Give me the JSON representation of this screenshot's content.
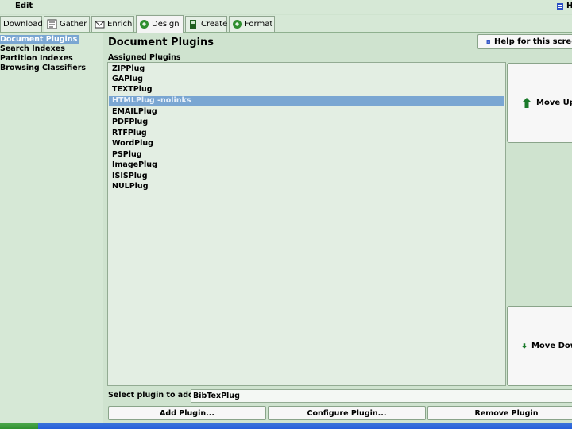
{
  "menu": {
    "edit_label": "Edit",
    "extra_label": "H"
  },
  "tabs": [
    {
      "label": "Download",
      "icon": "none"
    },
    {
      "label": "Gather",
      "icon": "notebook-icon"
    },
    {
      "label": "Enrich",
      "icon": "envelope-icon"
    },
    {
      "label": "Design",
      "icon": "gear-icon"
    },
    {
      "label": "Create",
      "icon": "phone-icon"
    },
    {
      "label": "Format",
      "icon": "gear-icon"
    }
  ],
  "active_tab": "Design",
  "sidebar": {
    "items": [
      {
        "label": "Document Plugins",
        "selected": true
      },
      {
        "label": "Search Indexes",
        "selected": false
      },
      {
        "label": "Partition Indexes",
        "selected": false
      },
      {
        "label": "Browsing Classifiers",
        "selected": false
      }
    ]
  },
  "panel": {
    "title": "Document Plugins",
    "help_label": "Help for this scree",
    "assigned_label": "Assigned Plugins",
    "plugins": [
      {
        "label": "ZIPPlug",
        "selected": false
      },
      {
        "label": "GAPlug",
        "selected": false
      },
      {
        "label": "TEXTPlug",
        "selected": false
      },
      {
        "label": "HTMLPlug -nolinks",
        "selected": true
      },
      {
        "label": "EMAILPlug",
        "selected": false
      },
      {
        "label": "PDFPlug",
        "selected": false
      },
      {
        "label": "RTFPlug",
        "selected": false
      },
      {
        "label": "WordPlug",
        "selected": false
      },
      {
        "label": "PSPlug",
        "selected": false
      },
      {
        "label": "ImagePlug",
        "selected": false
      },
      {
        "label": "ISISPlug",
        "selected": false
      },
      {
        "label": "NULPlug",
        "selected": false
      }
    ],
    "move_up_label": "Move Up",
    "move_down_label": "Move Dow",
    "select_label": "Select plugin to add:",
    "select_value": "BibTexPlug",
    "buttons": {
      "add": "Add Plugin...",
      "configure": "Configure Plugin...",
      "remove": "Remove Plugin"
    }
  },
  "colors": {
    "background": "#cfe3cf",
    "selection": "#7aa6d2",
    "list_bg": "#e3eee3",
    "arrow_green": "#1a7a2a"
  }
}
